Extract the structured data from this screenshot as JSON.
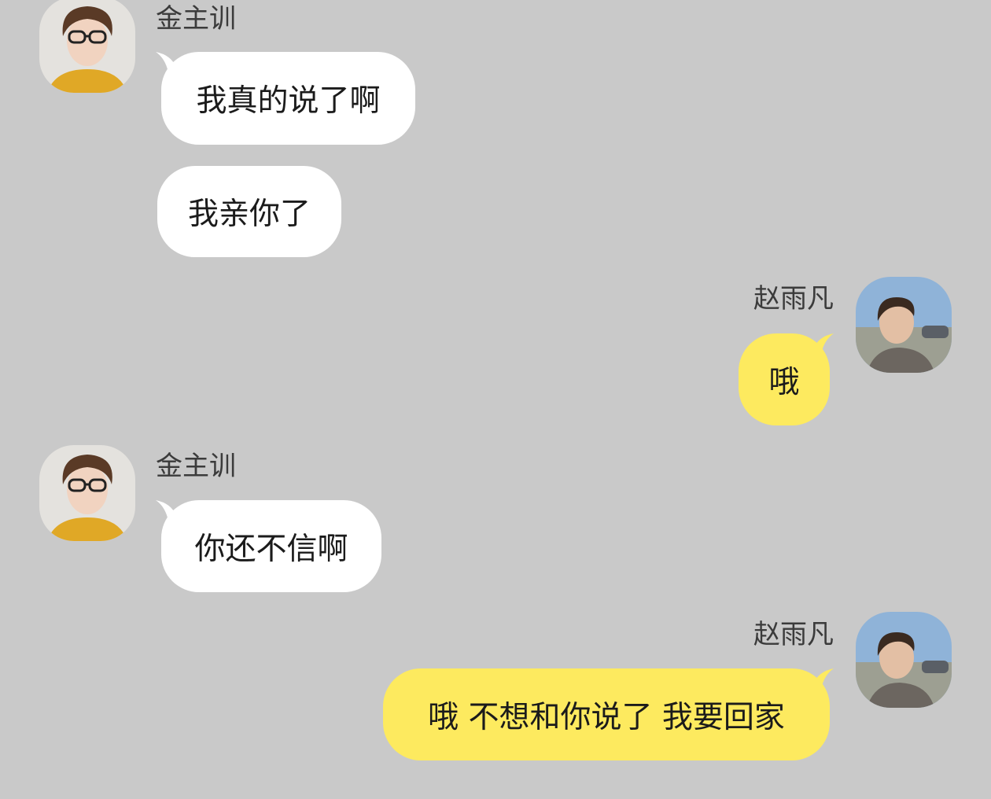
{
  "colors": {
    "background": "#c9c9c9",
    "incoming_bubble": "#ffffff",
    "outgoing_bubble": "#fdea5f",
    "name_text": "#3b3b3b",
    "message_text": "#1b1b1b"
  },
  "messages": [
    {
      "sender": "金主训",
      "side": "left",
      "show_header": true,
      "text": "我真的说了啊"
    },
    {
      "sender": "金主训",
      "side": "left",
      "show_header": false,
      "text": "我亲你了"
    },
    {
      "sender": "赵雨凡",
      "side": "right",
      "show_header": true,
      "text": "哦"
    },
    {
      "sender": "金主训",
      "side": "left",
      "show_header": true,
      "text": "你还不信啊"
    },
    {
      "sender": "赵雨凡",
      "side": "right",
      "show_header": true,
      "text": "哦 不想和你说了 我要回家"
    }
  ],
  "icons": {
    "left_avatar": "avatar-glasses-person-icon",
    "right_avatar": "avatar-outdoor-person-icon"
  }
}
